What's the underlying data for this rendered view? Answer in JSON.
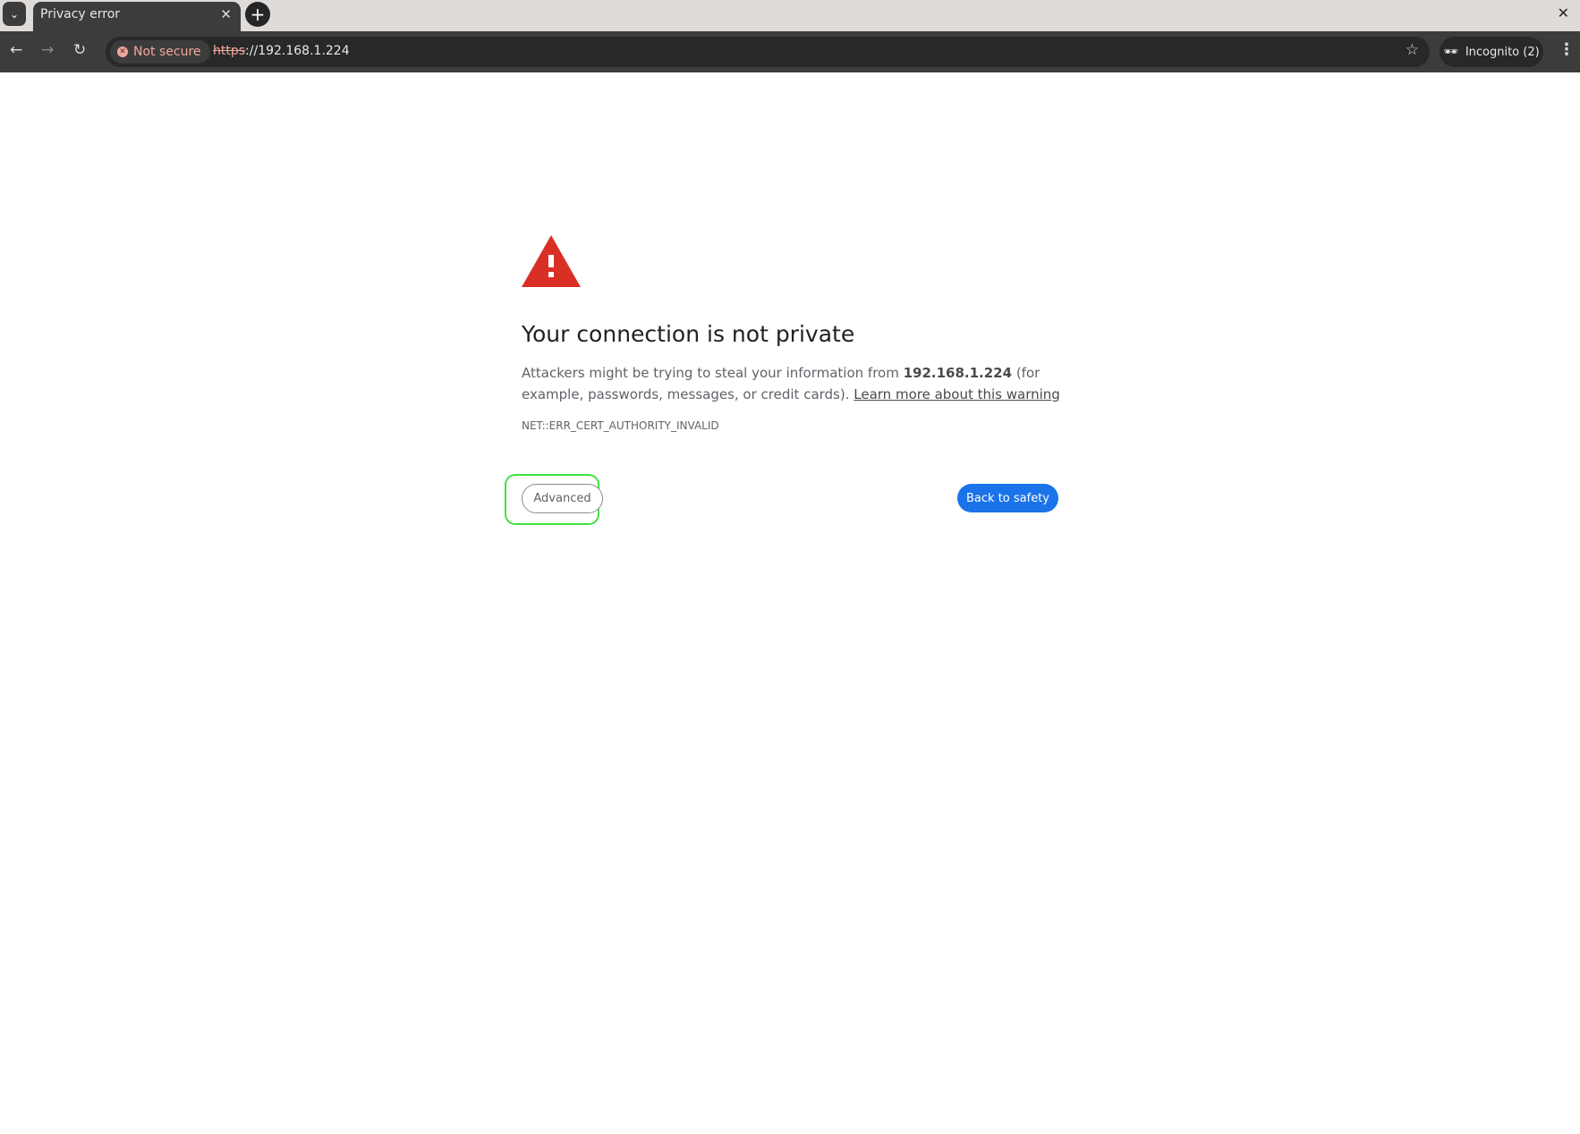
{
  "browser": {
    "tab_title": "Privacy error",
    "security_chip": "Not secure",
    "url_scheme": "https",
    "url_rest": "://192.168.1.224",
    "incognito_label": "Incognito (2)"
  },
  "page": {
    "title": "Your connection is not private",
    "desc_before": "Attackers might be trying to steal your information from ",
    "host": "192.168.1.224",
    "desc_after": " (for example, passwords, messages, or credit cards). ",
    "learn_more": "Learn more about this warning",
    "error_code": "NET::ERR_CERT_AUTHORITY_INVALID",
    "advanced_label": "Advanced",
    "back_label": "Back to safety"
  },
  "colors": {
    "warning": "#d93025",
    "primary": "#1a73e8",
    "highlight": "#3fe23f"
  }
}
